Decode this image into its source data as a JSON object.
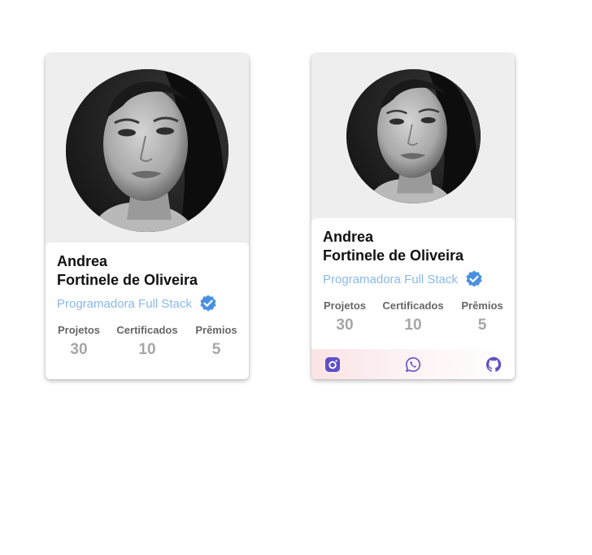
{
  "cards": [
    {
      "name_line1": "Andrea",
      "name_line2": "Fortinele de Oliveira",
      "role": "Programadora Full Stack",
      "verified_icon": "verified-badge-icon",
      "stats": [
        {
          "label": "Projetos",
          "value": "30"
        },
        {
          "label": "Certificados",
          "value": "10"
        },
        {
          "label": "Prêmios",
          "value": "5"
        }
      ]
    },
    {
      "name_line1": "Andrea",
      "name_line2": "Fortinele de Oliveira",
      "role": "Programadora Full Stack",
      "verified_icon": "verified-badge-icon",
      "stats": [
        {
          "label": "Projetos",
          "value": "30"
        },
        {
          "label": "Certificados",
          "value": "10"
        },
        {
          "label": "Prêmios",
          "value": "5"
        }
      ],
      "social": [
        "instagram-icon",
        "whatsapp-icon",
        "github-icon"
      ]
    }
  ],
  "colors": {
    "accent": "#5f4fc7",
    "verified": "#4a90e2",
    "role_text": "#8ab8ea",
    "top_background": "#eeeeee",
    "social_gradient_start": "#fbe3e5"
  }
}
